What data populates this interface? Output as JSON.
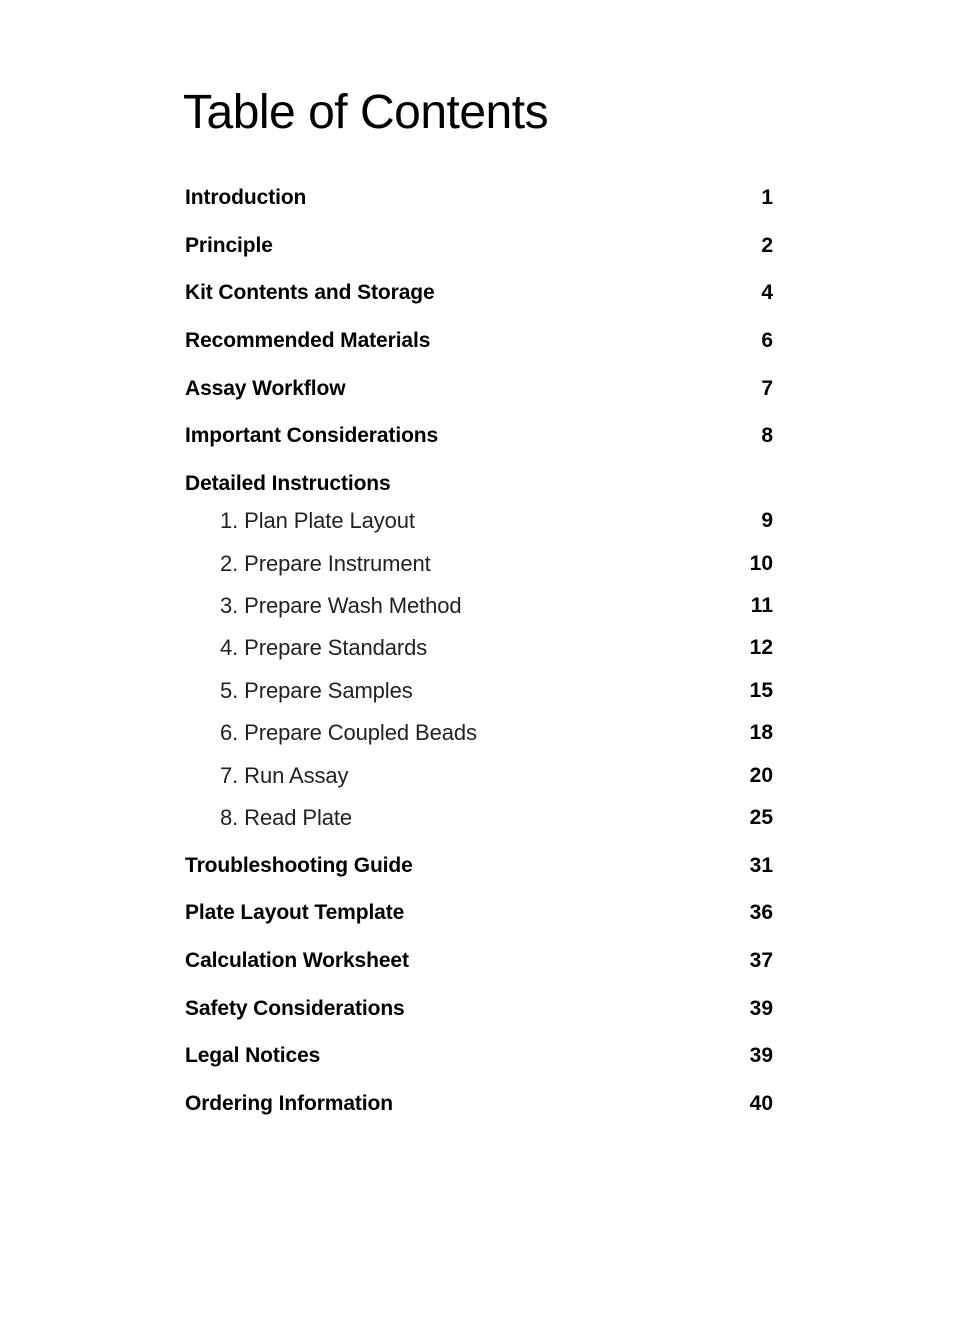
{
  "title": "Table of Contents",
  "entries": [
    {
      "label": "Introduction",
      "page": "1"
    },
    {
      "label": "Principle",
      "page": "2"
    },
    {
      "label": "Kit Contents and Storage",
      "page": "4"
    },
    {
      "label": "Recommended Materials",
      "page": "6"
    },
    {
      "label": "Assay Workflow",
      "page": "7"
    },
    {
      "label": "Important Considerations",
      "page": "8"
    },
    {
      "label": "Detailed Instructions",
      "page": ""
    },
    {
      "label": "Troubleshooting Guide",
      "page": "31"
    },
    {
      "label": "Plate Layout Template",
      "page": "36"
    },
    {
      "label": "Calculation Worksheet",
      "page": "37"
    },
    {
      "label": "Safety Considerations",
      "page": "39"
    },
    {
      "label": "Legal Notices",
      "page": "39"
    },
    {
      "label": "Ordering Information",
      "page": "40"
    }
  ],
  "detailed_instructions": [
    {
      "label": "1. Plan Plate Layout",
      "page": "9"
    },
    {
      "label": "2. Prepare Instrument",
      "page": "10"
    },
    {
      "label": "3. Prepare Wash Method",
      "page": "11"
    },
    {
      "label": "4. Prepare Standards",
      "page": "12"
    },
    {
      "label": "5. Prepare Samples",
      "page": "15"
    },
    {
      "label": "6. Prepare Coupled Beads",
      "page": "18"
    },
    {
      "label": "7. Run Assay",
      "page": "20"
    },
    {
      "label": "8. Read Plate",
      "page": "25"
    }
  ]
}
